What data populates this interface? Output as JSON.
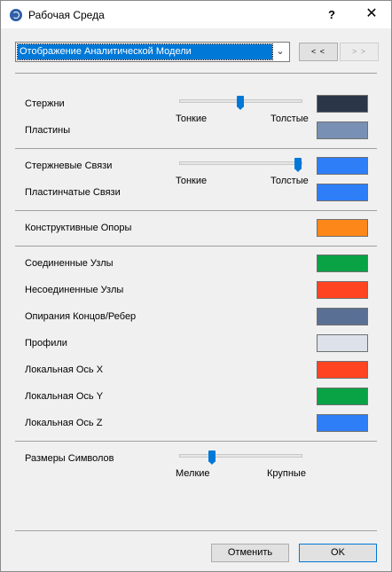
{
  "window": {
    "title": "Рабочая Среда",
    "help": "?",
    "close": "✕"
  },
  "view": {
    "selected": "Отображение Аналитической Модели",
    "prev": "< <",
    "next": "> >"
  },
  "members": {
    "bars_label": "Стержни",
    "plates_label": "Пластины",
    "thin": "Тонкие",
    "thick": "Толстые",
    "thickness_level": 0.5,
    "bars_color": "#2b3749",
    "plates_color": "#7890b4"
  },
  "links": {
    "bar_links_label": "Стержневые Связи",
    "plate_links_label": "Пластинчатые Связи",
    "thin": "Тонкие",
    "thick": "Толстые",
    "thickness_level": 1.0,
    "bar_links_color": "#2d7ef7",
    "plate_links_color": "#2d7ef7"
  },
  "supports": {
    "label": "Конструктивные Опоры",
    "color": "#fd8719"
  },
  "nodes": [
    {
      "label": "Соединенные Узлы",
      "color": "#09a345"
    },
    {
      "label": "Несоединенные Узлы",
      "color": "#ff4422"
    },
    {
      "label": "Опирания Концов/Ребер",
      "color": "#5a6f94"
    },
    {
      "label": "Профили",
      "color": "#dde2ea"
    },
    {
      "label": "Локальная Ось X",
      "color": "#ff4422"
    },
    {
      "label": "Локальная Ось Y",
      "color": "#09a345"
    },
    {
      "label": "Локальная Ось Z",
      "color": "#2d7ef7"
    }
  ],
  "symbols": {
    "label": "Размеры Символов",
    "small": "Мелкие",
    "large": "Крупные",
    "size_level": 0.26
  },
  "footer": {
    "cancel": "Отменить",
    "ok": "OK"
  }
}
